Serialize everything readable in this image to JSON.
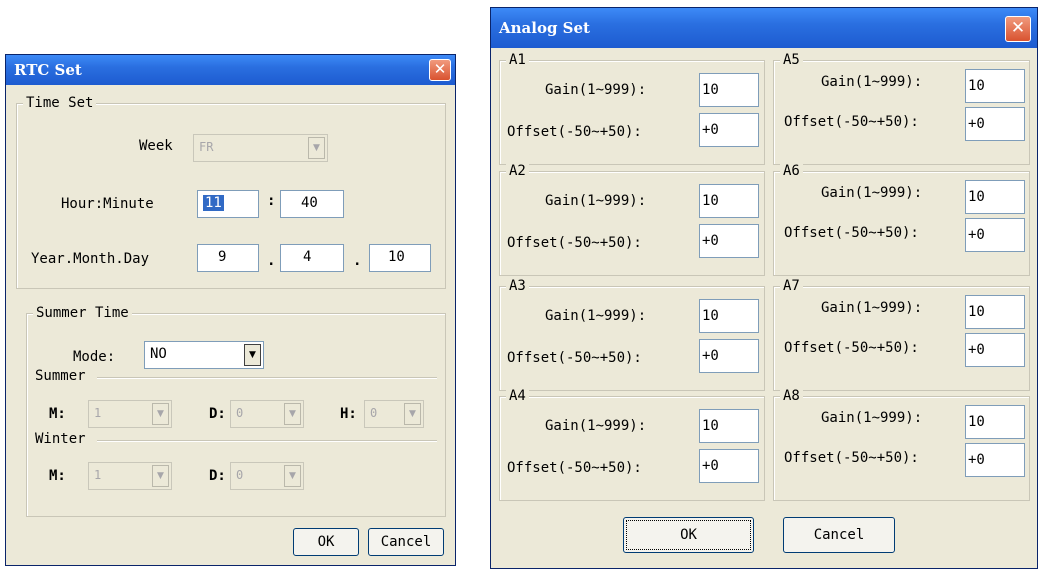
{
  "rtc": {
    "title": "RTC Set",
    "close": "✕",
    "time_set": {
      "legend": "Time Set",
      "week_label": "Week",
      "week_value": "FR",
      "hour_minute_label": "Hour:Minute",
      "hour": "11",
      "colon": ":",
      "minute": "40",
      "ymd_label": "Year.Month.Day",
      "year": "9",
      "dot1": ".",
      "month": "4",
      "dot2": ".",
      "day": "10"
    },
    "summer_time": {
      "legend": "Summer Time",
      "mode_label": "Mode:",
      "mode_value": "NO",
      "summer_legend": "Summer",
      "m_label": "M:",
      "m_value": "1",
      "d_label": "D:",
      "d_value": "0",
      "h_label": "H:",
      "h_value": "0",
      "winter_legend": "Winter",
      "wm_label": "M:",
      "wm_value": "1",
      "wd_label": "D:",
      "wd_value": "0"
    },
    "ok": "OK",
    "cancel": "Cancel"
  },
  "analog": {
    "title": "Analog Set",
    "close": "✕",
    "gain_label": "Gain(1~999):",
    "offset_label": "Offset(-50~+50):",
    "channels": [
      {
        "name": "A1",
        "gain": "10",
        "offset": "+0"
      },
      {
        "name": "A2",
        "gain": "10",
        "offset": "+0"
      },
      {
        "name": "A3",
        "gain": "10",
        "offset": "+0"
      },
      {
        "name": "A4",
        "gain": "10",
        "offset": "+0"
      },
      {
        "name": "A5",
        "gain": "10",
        "offset": "+0"
      },
      {
        "name": "A6",
        "gain": "10",
        "offset": "+0"
      },
      {
        "name": "A7",
        "gain": "10",
        "offset": "+0"
      },
      {
        "name": "A8",
        "gain": "10",
        "offset": "+0"
      }
    ],
    "ok": "OK",
    "cancel": "Cancel"
  }
}
